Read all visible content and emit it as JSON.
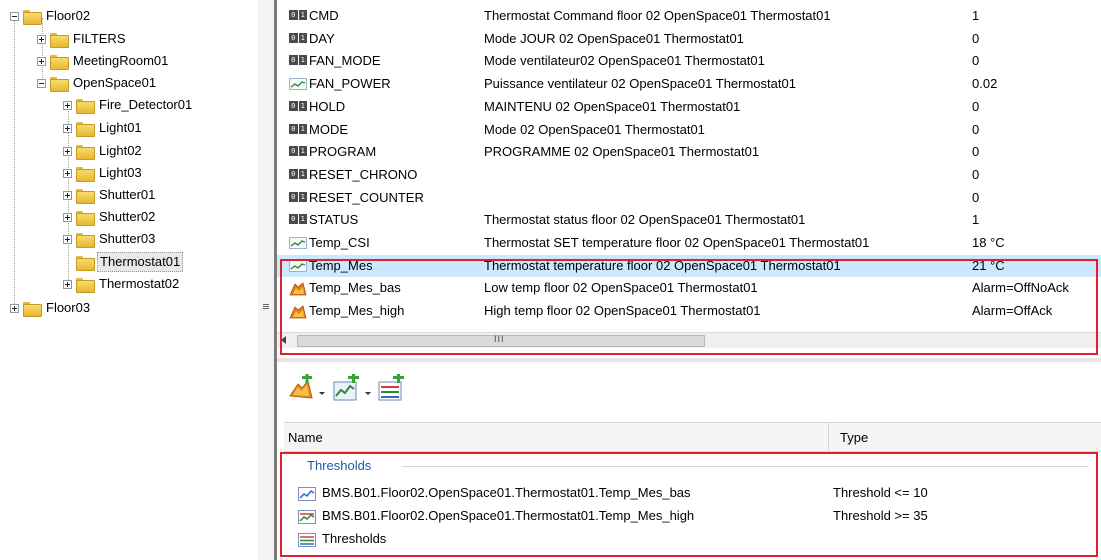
{
  "tree": {
    "items": [
      {
        "label": "Floor02",
        "expander": "minus"
      },
      {
        "label": "FILTERS",
        "expander": "plus"
      },
      {
        "label": "MeetingRoom01",
        "expander": "plus"
      },
      {
        "label": "OpenSpace01",
        "expander": "minus"
      },
      {
        "label": "Fire_Detector01",
        "expander": "plus"
      },
      {
        "label": "Light01",
        "expander": "plus"
      },
      {
        "label": "Light02",
        "expander": "plus"
      },
      {
        "label": "Light03",
        "expander": "plus"
      },
      {
        "label": "Shutter01",
        "expander": "plus"
      },
      {
        "label": "Shutter02",
        "expander": "plus"
      },
      {
        "label": "Shutter03",
        "expander": "plus"
      },
      {
        "label": "Thermostat01",
        "expander": "none",
        "selected": true
      },
      {
        "label": "Thermostat02",
        "expander": "plus"
      },
      {
        "label": "Floor03",
        "expander": "plus"
      }
    ]
  },
  "variables": [
    {
      "icon": "digital-variable-icon",
      "name": "CMD",
      "desc": "Thermostat Command floor 02 OpenSpace01 Thermostat01",
      "value": "1"
    },
    {
      "icon": "digital-variable-icon",
      "name": "DAY",
      "desc": "Mode JOUR 02 OpenSpace01 Thermostat01",
      "value": "0"
    },
    {
      "icon": "digital-variable-icon",
      "name": "FAN_MODE",
      "desc": "Mode ventilateur02 OpenSpace01 Thermostat01",
      "value": "0"
    },
    {
      "icon": "analog-variable-icon",
      "name": "FAN_POWER",
      "desc": "Puissance ventilateur 02 OpenSpace01 Thermostat01",
      "value": "0.02"
    },
    {
      "icon": "digital-variable-icon",
      "name": "HOLD",
      "desc": "MAINTENU 02 OpenSpace01 Thermostat01",
      "value": "0"
    },
    {
      "icon": "digital-variable-icon",
      "name": "MODE",
      "desc": "Mode 02 OpenSpace01 Thermostat01",
      "value": "0"
    },
    {
      "icon": "digital-variable-icon",
      "name": "PROGRAM",
      "desc": "PROGRAMME 02 OpenSpace01 Thermostat01",
      "value": "0"
    },
    {
      "icon": "digital-variable-icon",
      "name": "RESET_CHRONO",
      "desc": "",
      "value": "0"
    },
    {
      "icon": "digital-variable-icon",
      "name": "RESET_COUNTER",
      "desc": "",
      "value": "0"
    },
    {
      "icon": "digital-variable-icon",
      "name": "STATUS",
      "desc": "Thermostat status floor 02 OpenSpace01 Thermostat01",
      "value": "1"
    },
    {
      "icon": "analog-variable-icon",
      "name": "Temp_CSI",
      "desc": "Thermostat SET temperature floor 02 OpenSpace01 Thermostat01",
      "value": "18 °C"
    },
    {
      "icon": "analog-variable-icon",
      "name": "Temp_Mes",
      "desc": "Thermostat temperature floor 02 OpenSpace01 Thermostat01",
      "value": "21 °C",
      "selected": true
    },
    {
      "icon": "alarm-variable-icon",
      "name": "Temp_Mes_bas",
      "desc": "Low temp floor 02 OpenSpace01 Thermostat01",
      "value": "Alarm=OffNoAck"
    },
    {
      "icon": "alarm-variable-icon",
      "name": "Temp_Mes_high",
      "desc": "High temp floor 02 OpenSpace01 Thermostat01",
      "value": "Alarm=OffAck"
    }
  ],
  "scrollbar": {
    "thumb_text": "III"
  },
  "lower": {
    "columns": {
      "name": "Name",
      "type": "Type"
    },
    "group_label": "Thresholds",
    "rows": [
      {
        "icon": "threshold-low-icon",
        "name": "BMS.B01.Floor02.OpenSpace01.Thermostat01.Temp_Mes_bas",
        "type": "Threshold <= 10"
      },
      {
        "icon": "threshold-high-icon",
        "name": "BMS.B01.Floor02.OpenSpace01.Thermostat01.Temp_Mes_high",
        "type": "Threshold >= 35"
      },
      {
        "icon": "thresholds-icon",
        "name": "Thresholds",
        "type": ""
      }
    ]
  },
  "colors": {
    "selection": "#cce8ff",
    "highlight_border": "#e3202a",
    "group_label": "#2158a8"
  }
}
